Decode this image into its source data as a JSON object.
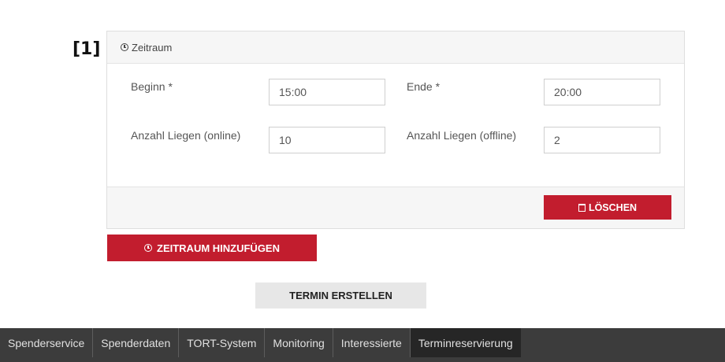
{
  "marker": "[1]",
  "panel": {
    "title": "Zeitraum",
    "fields": {
      "beginn_label": "Beginn *",
      "beginn_value": "15:00",
      "ende_label": "Ende *",
      "ende_value": "20:00",
      "online_label": "Anzahl Liegen (online)",
      "online_value": "10",
      "offline_label": "Anzahl Liegen (offline)",
      "offline_value": "2"
    },
    "delete_label": "LÖSCHEN"
  },
  "add_timespan_label": "ZEITRAUM HINZUFÜGEN",
  "create_appointment_label": "TERMIN ERSTELLEN",
  "nav": {
    "items": [
      "Spenderservice",
      "Spenderdaten",
      "TORT-System",
      "Monitoring",
      "Interessierte",
      "Terminreservierung"
    ],
    "active": "Terminreservierung"
  },
  "colors": {
    "accent": "#c21d2e",
    "nav_bg": "#3c3c3c",
    "nav_active": "#262626"
  }
}
